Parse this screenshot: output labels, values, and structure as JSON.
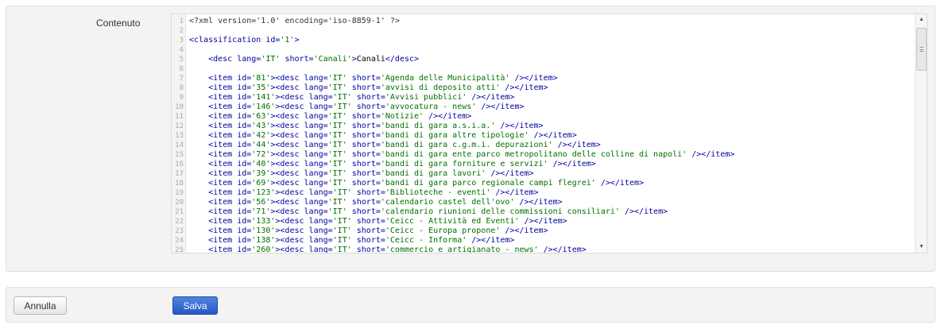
{
  "form": {
    "content_label": "Contenuto"
  },
  "editor": {
    "lines": [
      {
        "n": "1",
        "parts": [
          {
            "t": "<?xml version='1.0' encoding='iso-8859-1' ?>",
            "c": "decl"
          }
        ]
      },
      {
        "n": "2",
        "parts": []
      },
      {
        "n": "3",
        "parts": [
          {
            "t": "<classification ",
            "c": "tag"
          },
          {
            "t": "id=",
            "c": "attr"
          },
          {
            "t": "'1'",
            "c": "str"
          },
          {
            "t": ">",
            "c": "tag"
          }
        ]
      },
      {
        "n": "4",
        "parts": []
      },
      {
        "n": "5",
        "parts": [
          {
            "t": "    <desc ",
            "c": "tag"
          },
          {
            "t": "lang=",
            "c": "attr"
          },
          {
            "t": "'IT' ",
            "c": "str"
          },
          {
            "t": "short=",
            "c": "attr"
          },
          {
            "t": "'Canali'",
            "c": "str"
          },
          {
            "t": ">",
            "c": "tag"
          },
          {
            "t": "Canali",
            "c": "txt"
          },
          {
            "t": "</desc>",
            "c": "tag"
          }
        ]
      },
      {
        "n": "6",
        "parts": []
      },
      {
        "n": "7",
        "item": [
          "'81'",
          "'Agenda delle Municipalità'"
        ]
      },
      {
        "n": "8",
        "item": [
          "'35'",
          "'avvisi di deposito atti'"
        ]
      },
      {
        "n": "9",
        "item": [
          "'141'",
          "'Avvisi pubblici'"
        ]
      },
      {
        "n": "10",
        "item": [
          "'146'",
          "'avvocatura - news'"
        ]
      },
      {
        "n": "11",
        "item": [
          "'63'",
          "'Notizie'"
        ]
      },
      {
        "n": "12",
        "item": [
          "'43'",
          "'bandi di gara a.s.i.a.'"
        ]
      },
      {
        "n": "13",
        "item": [
          "'42'",
          "'bandi di gara altre tipologie'"
        ]
      },
      {
        "n": "14",
        "item": [
          "'44'",
          "'bandi di gara c.g.m.i. depurazioni'"
        ]
      },
      {
        "n": "15",
        "item": [
          "'72'",
          "'bandi di gara ente parco metropolitano delle colline di napoli'"
        ]
      },
      {
        "n": "16",
        "item": [
          "'40'",
          "'bandi di gara forniture e servizi'"
        ]
      },
      {
        "n": "17",
        "item": [
          "'39'",
          "'bandi di gara lavori'"
        ]
      },
      {
        "n": "18",
        "item": [
          "'69'",
          "'bandi di gara parco regionale campi flegrei'"
        ]
      },
      {
        "n": "19",
        "item": [
          "'123'",
          "'Biblioteche - eventi'"
        ]
      },
      {
        "n": "20",
        "item": [
          "'56'",
          "'calendario castel dell'ovo'"
        ]
      },
      {
        "n": "21",
        "item": [
          "'71'",
          "'calendario riunioni delle commissioni consiliari'"
        ]
      },
      {
        "n": "22",
        "item": [
          "'133'",
          "'Ceicc - Attività ed Eventi'"
        ]
      },
      {
        "n": "23",
        "item": [
          "'130'",
          "'Ceicc - Europa propone'"
        ]
      },
      {
        "n": "24",
        "item": [
          "'138'",
          "'Ceicc - Informa'"
        ]
      },
      {
        "n": "25",
        "item": [
          "'260'",
          "'commercio e artigianato - news'"
        ]
      }
    ]
  },
  "buttons": {
    "cancel": "Annulla",
    "save": "Salva"
  },
  "scrollbar": {
    "up_arrow": "▲",
    "down_arrow": "▼"
  }
}
